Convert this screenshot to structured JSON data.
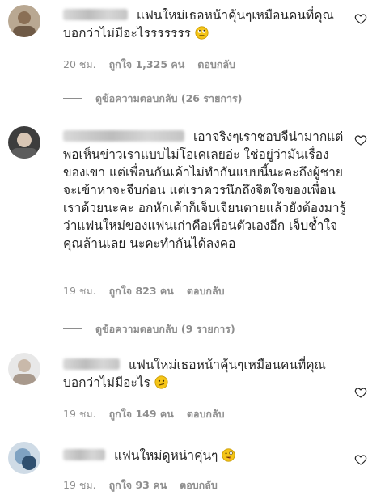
{
  "comments": [
    {
      "text": "แฟนใหม่เธอหน้าคุ้นๆเหมือนคนที่คุณบอกว่าไม่มีอะไรรรรรรร",
      "time": "20 ชม.",
      "likes": "ถูกใจ 1,325 คน",
      "reply": "ตอบกลับ",
      "emoji": "rolling-eyes-emoji",
      "view_replies": "ดูข้อความตอบกลับ (26 รายการ)"
    },
    {
      "text": "เอาจริงๆเราชอบจีน่ามากแต่พอเห็นข่าวเราแบบไม่โอเคเลยอ่ะ ใช่อยู่ว่ามันเรื่องของเขา แต่เพื่อนกันเค้าไม่ทำกันแบบนี้นะคะถึงผู้ชายจะเข้าหาจะจีบก่อน แต่เราควรนึกถึงจิตใจของเพื่อนเราด้วยนะคะ อกหักเค้าก็เจ็บเจียนตายแล้วยังต้องมารู้ว่าแฟนใหม่ของแฟนเก่าคือเพื่อนตัวเองอีก เจ็บช้ำใจคุณล้านเลย นะคะทำกันได้ลงคอ",
      "time": "19 ชม.",
      "likes": "ถูกใจ 823 คน",
      "reply": "ตอบกลับ",
      "view_replies": "ดูข้อความตอบกลับ (9 รายการ)"
    },
    {
      "text": "แฟนใหม่เธอหน้าคุ้นๆเหมือนคนที่คุณบอกว่าไม่มีอะไร",
      "time": "19 ชม.",
      "likes": "ถูกใจ 149 คน",
      "reply": "ตอบกลับ",
      "emoji": "confused-face-emoji"
    },
    {
      "text": "แฟนใหม่ดูหน่าคุ่นๆ",
      "time": "19 ชม.",
      "likes": "ถูกใจ 93 คน",
      "reply": "ตอบกลับ",
      "emoji": "zany-face-emoji"
    }
  ],
  "colors": {
    "text": "#262626",
    "meta": "#8e8e8e",
    "emoji": "#f5c518"
  },
  "icons": {
    "like": "heart-outline-icon"
  }
}
